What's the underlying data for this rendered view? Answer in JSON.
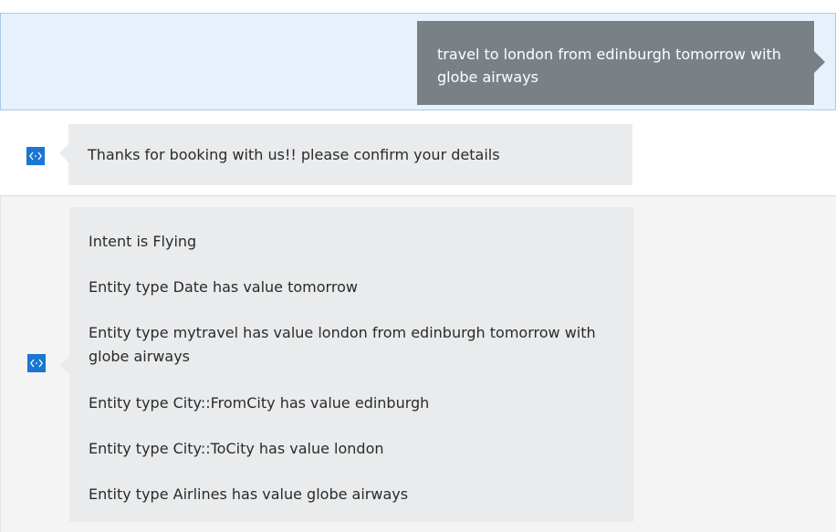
{
  "conversation": {
    "user_message": "travel to london from edinburgh tomorrow with globe airways",
    "bot_reply_1": "Thanks for booking with us!! please confirm your details",
    "bot_reply_2_lines": [
      "Intent is Flying",
      "Entity type Date has value tomorrow",
      "Entity type mytravel has value london from edinburgh tomorrow with globe airways",
      "Entity type City::FromCity has value edinburgh",
      "Entity type City::ToCity has value london",
      "Entity type Airlines has value globe airways"
    ]
  },
  "icons": {
    "bot_avatar": "bot-code-icon"
  },
  "colors": {
    "user_row_bg": "#e6f1fb",
    "user_row_border": "#a6cbea",
    "user_bubble": "#7a8186",
    "bot_bubble": "#e9ebed",
    "bot_icon": "#1976d2"
  }
}
